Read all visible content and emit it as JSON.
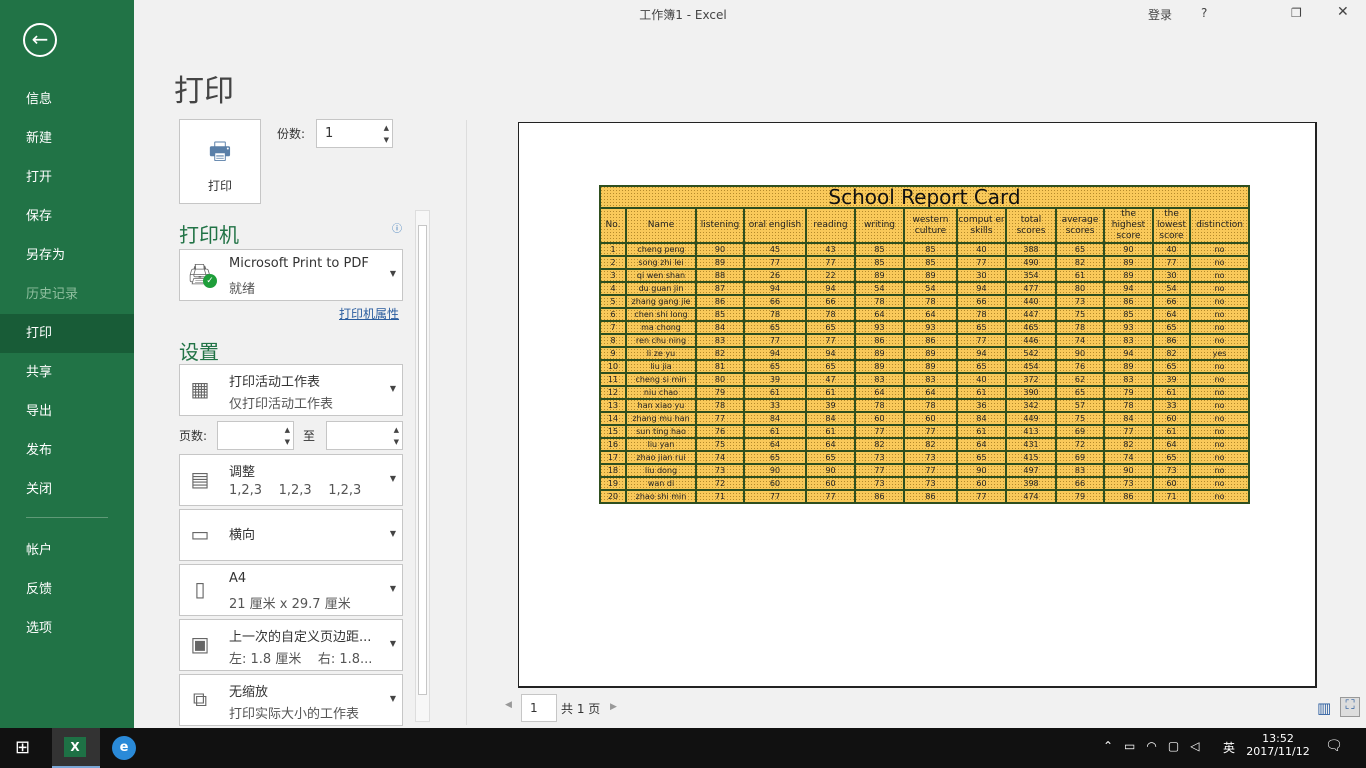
{
  "window": {
    "title": "工作簿1  -  Excel",
    "login": "登录",
    "help": "?"
  },
  "sidebar": {
    "items": [
      "信息",
      "新建",
      "打开",
      "保存",
      "另存为",
      "历史记录",
      "打印",
      "共享",
      "导出",
      "发布",
      "关闭",
      "帐户",
      "反馈",
      "选项"
    ]
  },
  "print": {
    "title": "打印",
    "print_label": "打印",
    "copies_label": "份数:",
    "copies_value": "1",
    "printer_heading": "打印机",
    "printer_name": "Microsoft Print to PDF",
    "printer_status": "就绪",
    "printer_props": "打印机属性",
    "settings_heading": "设置",
    "what": {
      "l1": "打印活动工作表",
      "l2": "仅打印活动工作表"
    },
    "pages_label": "页数:",
    "to_label": "至",
    "collate": {
      "l1": "调整",
      "l2": "1,2,3    1,2,3    1,2,3"
    },
    "orientation": {
      "l1": "横向",
      "l2": ""
    },
    "paper": {
      "l1": "A4",
      "l2": "21 厘米 x 29.7 厘米"
    },
    "margins": {
      "l1": "上一次的自定义页边距...",
      "l2": "左: 1.8 厘米    右: 1.8..."
    },
    "scaling": {
      "l1": "无缩放",
      "l2": "打印实际大小的工作表"
    },
    "page_num": "1",
    "page_total": "共 1 页"
  },
  "report": {
    "title": "School Report Card",
    "headers": [
      "No.",
      "Name",
      "listening",
      "oral english",
      "reading",
      "writing",
      "western culture",
      "comput er skills",
      "total scores",
      "average scores",
      "the highest score",
      "the lowest score",
      "distinction"
    ],
    "rows": [
      [
        "1",
        "cheng peng",
        "90",
        "45",
        "43",
        "85",
        "85",
        "40",
        "388",
        "65",
        "90",
        "40",
        "no"
      ],
      [
        "2",
        "song zhi lei",
        "89",
        "77",
        "77",
        "85",
        "85",
        "77",
        "490",
        "82",
        "89",
        "77",
        "no"
      ],
      [
        "3",
        "qi wen shan",
        "88",
        "26",
        "22",
        "89",
        "89",
        "30",
        "354",
        "61",
        "89",
        "30",
        "no"
      ],
      [
        "4",
        "du guan jin",
        "87",
        "94",
        "94",
        "54",
        "54",
        "94",
        "477",
        "80",
        "94",
        "54",
        "no"
      ],
      [
        "5",
        "zhang gang jie",
        "86",
        "66",
        "66",
        "78",
        "78",
        "66",
        "440",
        "73",
        "86",
        "66",
        "no"
      ],
      [
        "6",
        "chen shi long",
        "85",
        "78",
        "78",
        "64",
        "64",
        "78",
        "447",
        "75",
        "85",
        "64",
        "no"
      ],
      [
        "7",
        "ma chong",
        "84",
        "65",
        "65",
        "93",
        "93",
        "65",
        "465",
        "78",
        "93",
        "65",
        "no"
      ],
      [
        "8",
        "ren chu ning",
        "83",
        "77",
        "77",
        "86",
        "86",
        "77",
        "446",
        "74",
        "83",
        "86",
        "no"
      ],
      [
        "9",
        "li ze yu",
        "82",
        "94",
        "94",
        "89",
        "89",
        "94",
        "542",
        "90",
        "94",
        "82",
        "yes"
      ],
      [
        "10",
        "liu jia",
        "81",
        "65",
        "65",
        "89",
        "89",
        "65",
        "454",
        "76",
        "89",
        "65",
        "no"
      ],
      [
        "11",
        "cheng si min",
        "80",
        "39",
        "47",
        "83",
        "83",
        "40",
        "372",
        "62",
        "83",
        "39",
        "no"
      ],
      [
        "12",
        "niu chao",
        "79",
        "61",
        "61",
        "64",
        "64",
        "61",
        "390",
        "65",
        "79",
        "61",
        "no"
      ],
      [
        "13",
        "han xiao yu",
        "78",
        "33",
        "39",
        "78",
        "78",
        "36",
        "342",
        "57",
        "78",
        "33",
        "no"
      ],
      [
        "14",
        "zhang mu han",
        "77",
        "84",
        "84",
        "60",
        "60",
        "84",
        "449",
        "75",
        "84",
        "60",
        "no"
      ],
      [
        "15",
        "sun ting hao",
        "76",
        "61",
        "61",
        "77",
        "77",
        "61",
        "413",
        "69",
        "77",
        "61",
        "no"
      ],
      [
        "16",
        "liu yan",
        "75",
        "64",
        "64",
        "82",
        "82",
        "64",
        "431",
        "72",
        "82",
        "64",
        "no"
      ],
      [
        "17",
        "zhao jian rui",
        "74",
        "65",
        "65",
        "73",
        "73",
        "65",
        "415",
        "69",
        "74",
        "65",
        "no"
      ],
      [
        "18",
        "liu dong",
        "73",
        "90",
        "90",
        "77",
        "77",
        "90",
        "497",
        "83",
        "90",
        "73",
        "no"
      ],
      [
        "19",
        "wan di",
        "72",
        "60",
        "60",
        "73",
        "73",
        "60",
        "398",
        "66",
        "73",
        "60",
        "no"
      ],
      [
        "20",
        "zhao shi min",
        "71",
        "77",
        "77",
        "86",
        "86",
        "77",
        "474",
        "79",
        "86",
        "71",
        "no"
      ]
    ]
  },
  "taskbar": {
    "ime": "英",
    "time": "13:52",
    "date": "2017/11/12"
  }
}
